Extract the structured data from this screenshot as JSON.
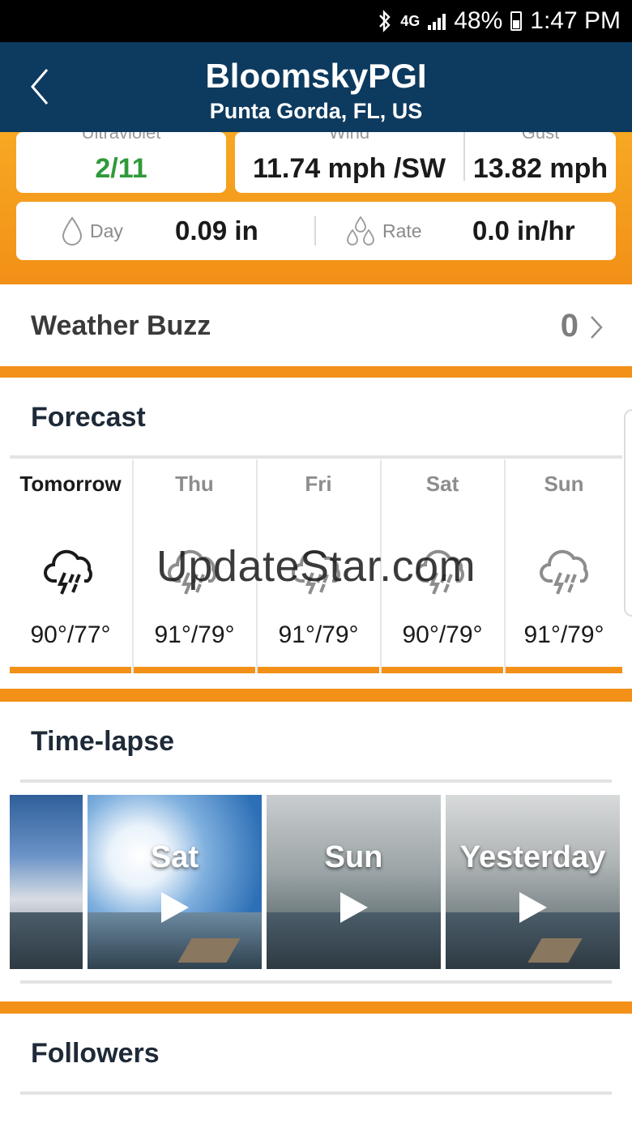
{
  "status_bar": {
    "network": "4G",
    "battery": "48%",
    "time": "1:47 PM"
  },
  "header": {
    "title": "BloomskyPGI",
    "subtitle": "Punta Gorda, FL,  US"
  },
  "stats": {
    "uv": {
      "label": "Ultraviolet",
      "value": "2/11"
    },
    "wind": {
      "label": "Wind",
      "value": "11.74 mph /SW"
    },
    "gust": {
      "label": "Gust",
      "value": "13.82 mph"
    },
    "rain_day": {
      "label": "Day",
      "value": "0.09 in"
    },
    "rain_rate": {
      "label": "Rate",
      "value": "0.0 in/hr"
    }
  },
  "weather_buzz": {
    "label": "Weather Buzz",
    "count": "0"
  },
  "forecast": {
    "title": "Forecast",
    "days": [
      {
        "name": "Tomorrow",
        "temps": "90°/77°"
      },
      {
        "name": "Thu",
        "temps": "91°/79°"
      },
      {
        "name": "Fri",
        "temps": "91°/79°"
      },
      {
        "name": "Sat",
        "temps": "90°/79°"
      },
      {
        "name": "Sun",
        "temps": "91°/79°"
      }
    ]
  },
  "watermark": "UpdateStar.com",
  "timelapse": {
    "title": "Time-lapse",
    "items": [
      {
        "label": ""
      },
      {
        "label": "Sat"
      },
      {
        "label": "Sun"
      },
      {
        "label": "Yesterday"
      }
    ]
  },
  "followers": {
    "title": "Followers"
  },
  "colors": {
    "header": "#0d3a5f",
    "accent": "#f29017",
    "uv_green": "#2f9a3a"
  }
}
